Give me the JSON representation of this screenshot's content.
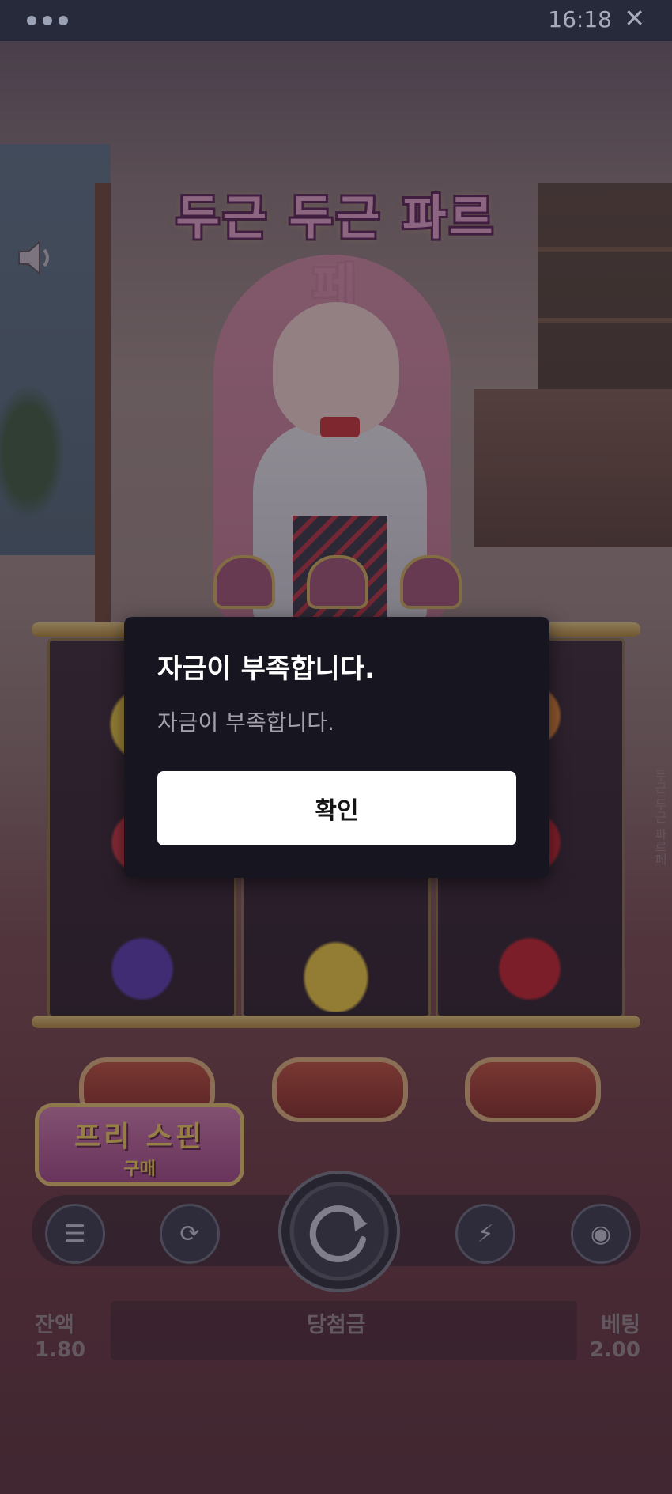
{
  "status_bar": {
    "time": "16:18",
    "close_icon": "close-icon",
    "menu_icon": "more-dots-icon"
  },
  "game": {
    "title": "두근 두근 파르페",
    "free_spin": {
      "line1": "프리 스핀",
      "line2": "구매"
    },
    "side_label": "두근 두근 파르페",
    "symbols_visible": [
      "banana",
      "strawberry",
      "grape",
      "banana",
      "cherry",
      "cherry",
      "orange"
    ],
    "controls": {
      "menu_icon": "menu-icon",
      "autoplay_icon": "autoplay-icon",
      "spin_icon": "spin-icon",
      "turbo_icon": "turbo-icon",
      "bet_icon": "coins-icon"
    },
    "balance": {
      "label": "잔액",
      "value": "1.80"
    },
    "win": {
      "label": "당첨금"
    },
    "bet": {
      "label": "베팅",
      "value": "2.00"
    }
  },
  "dialog": {
    "title": "자금이 부족합니다.",
    "message": "자금이 부족합니다.",
    "confirm_label": "확인"
  },
  "colors": {
    "dialog_bg": "#171520",
    "dialog_button": "#ffffff",
    "topbar": "#262a3a"
  }
}
